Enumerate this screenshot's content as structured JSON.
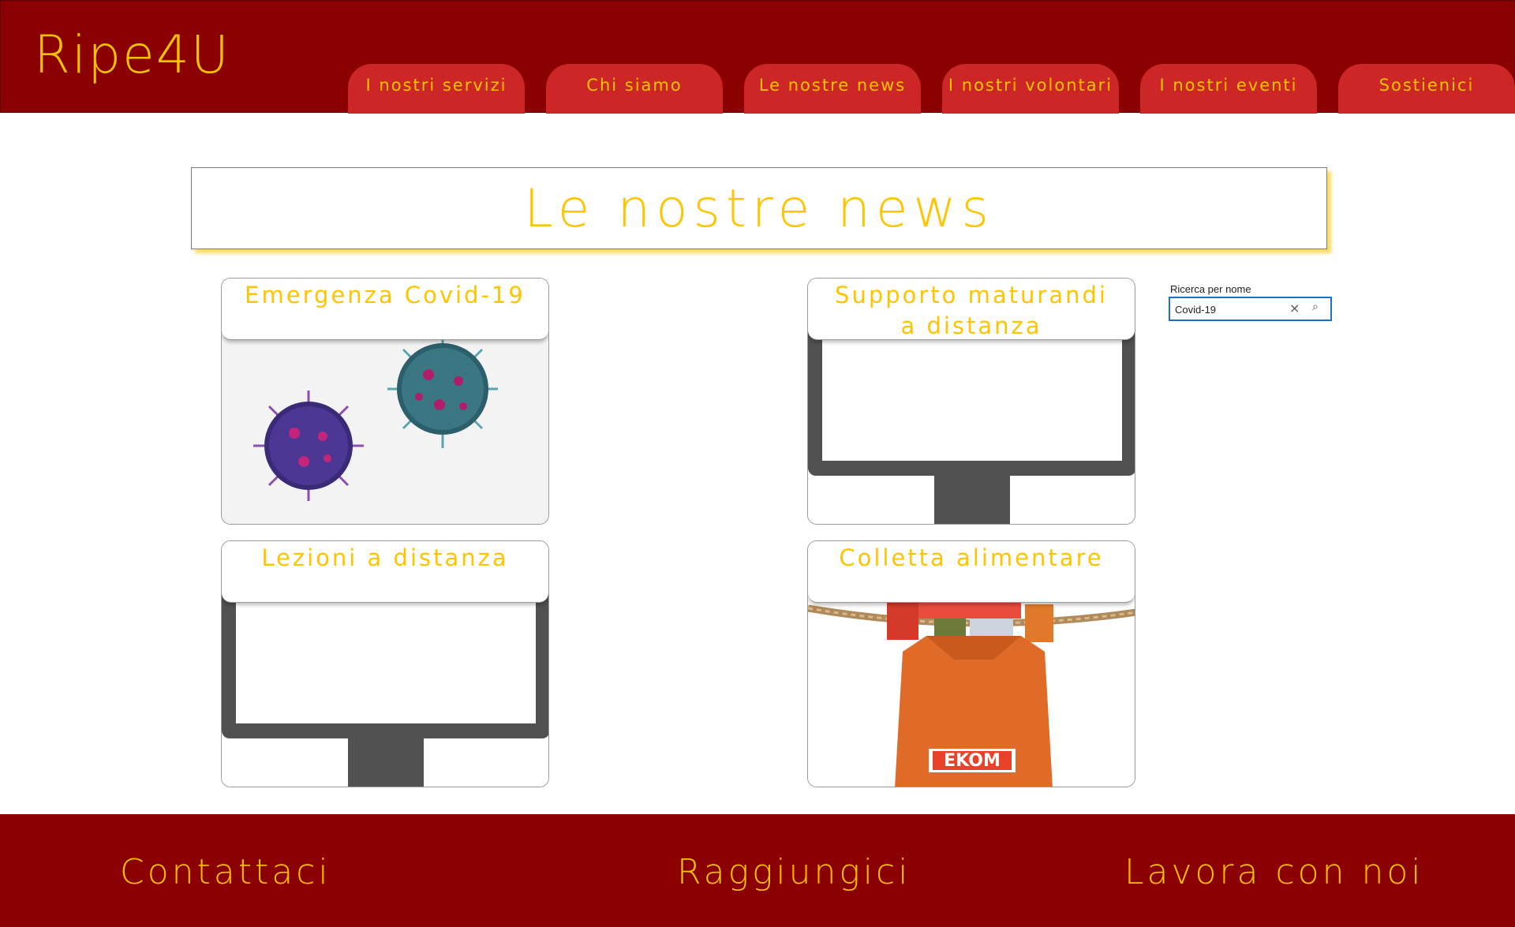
{
  "header": {
    "logo": "Ripe4U",
    "nav": [
      {
        "label": "I nostri servizi"
      },
      {
        "label": "Chi siamo"
      },
      {
        "label": "Le nostre news"
      },
      {
        "label": "I nostri volontari"
      },
      {
        "label": "I nostri eventi"
      },
      {
        "label": "Sostienici"
      }
    ]
  },
  "main": {
    "title": "Le nostre news",
    "cards": [
      {
        "title": "Emergenza Covid-19",
        "image": "coronavirus-image"
      },
      {
        "title": "Supporto maturandi\na distanza",
        "image": "monitor-image"
      },
      {
        "title": "Lezioni a distanza",
        "image": "monitor-image"
      },
      {
        "title": "Colletta alimentare",
        "image": "grocery-bag-image",
        "brand": "EKOM"
      }
    ]
  },
  "search": {
    "label": "Ricerca per nome",
    "value": "Covid-19",
    "clear_icon": "×",
    "search_icon": "⌕"
  },
  "footer": {
    "links": [
      {
        "label": "Contattaci"
      },
      {
        "label": "Raggiungici"
      },
      {
        "label": "Lavora con noi"
      }
    ]
  },
  "colors": {
    "header_bg": "#8b0000",
    "tab_bg": "#cd2626",
    "accent_text": "#ffc400"
  }
}
